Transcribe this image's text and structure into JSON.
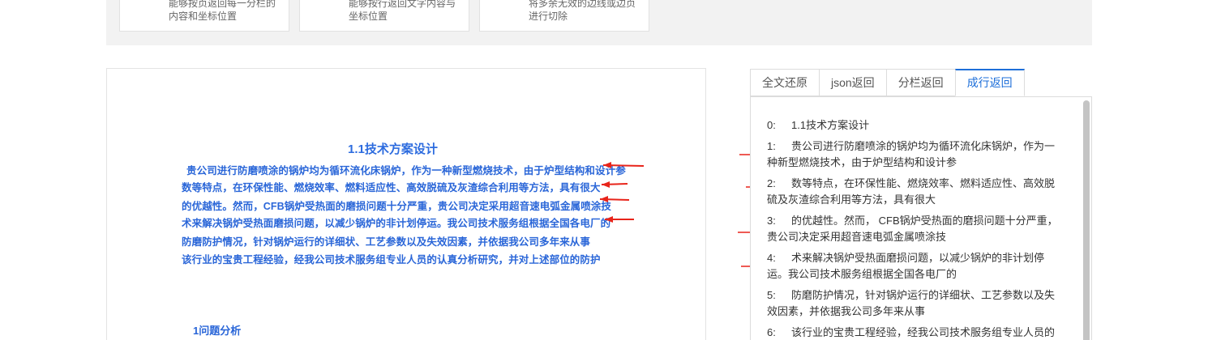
{
  "features": [
    {
      "line1": "能够按页返回每一分栏的",
      "line2": "内容和坐标位置"
    },
    {
      "line1": "能够按行返回文字内容与",
      "line2": "坐标位置"
    },
    {
      "line1": "将多余无效的边线或边页",
      "line2": "进行切除"
    }
  ],
  "document": {
    "title": "1.1技术方案设计",
    "lines": [
      "贵公司进行防磨喷涂的锅炉均为循环流化床锅炉，作为一种新型燃烧技术，由于炉型结构和设计参",
      "数等特点，在环保性能、燃烧效率、燃料适应性、高效脱硫及灰渣综合利用等方法，具有很大",
      "的优越性。然而，CFB锅炉受热面的磨损问题十分严重，贵公司决定采用超音速电弧金属喷涂技",
      "术来解决锅炉受热面磨损问题，以减少锅炉的非计划停运。我公司技术服务组根据全国各电厂的",
      "防磨防护情况，针对锅炉运行的详细状、工艺参数以及失效因素，并依据我公司多年来从事",
      "该行业的宝贵工程经验，经我公司技术服务组专业人员的认真分析研究，并对上述部位的防护"
    ],
    "section": "1问题分析"
  },
  "tabs": [
    {
      "label": "全文还原",
      "active": false
    },
    {
      "label": "json返回",
      "active": false
    },
    {
      "label": "分栏返回",
      "active": false
    },
    {
      "label": "成行返回",
      "active": true
    }
  ],
  "results": [
    {
      "index": "0:",
      "text": "1.1技术方案设计"
    },
    {
      "index": "1:",
      "text": "贵公司进行防磨喷涂的锅炉均为循环流化床锅炉，作为一种新型燃烧技术，由于炉型结构和设计参"
    },
    {
      "index": "2:",
      "text": "数等特点，在环保性能、燃烧效率、燃料适应性、高效脱硫及灰渣综合利用等方法，具有很大"
    },
    {
      "index": "3:",
      "text": "的优越性。然而， CFB锅炉受热面的磨损问题十分严重，贵公司决定采用超音速电弧金属喷涂技"
    },
    {
      "index": "4:",
      "text": "术来解决锅炉受热面磨损问题，以减少锅炉的非计划停运。我公司技术服务组根据全国各电厂的"
    },
    {
      "index": "5:",
      "text": "防磨防护情况，针对锅炉运行的详细状、工艺参数以及失效因素，并依据我公司多年来从事"
    },
    {
      "index": "6:",
      "text": "该行业的宝贵工程经验，经我公司技术服务组专业人员的"
    }
  ],
  "colors": {
    "accent": "#1e6fd9",
    "doc_text": "#2a66d8",
    "arrow": "#e8241a"
  }
}
